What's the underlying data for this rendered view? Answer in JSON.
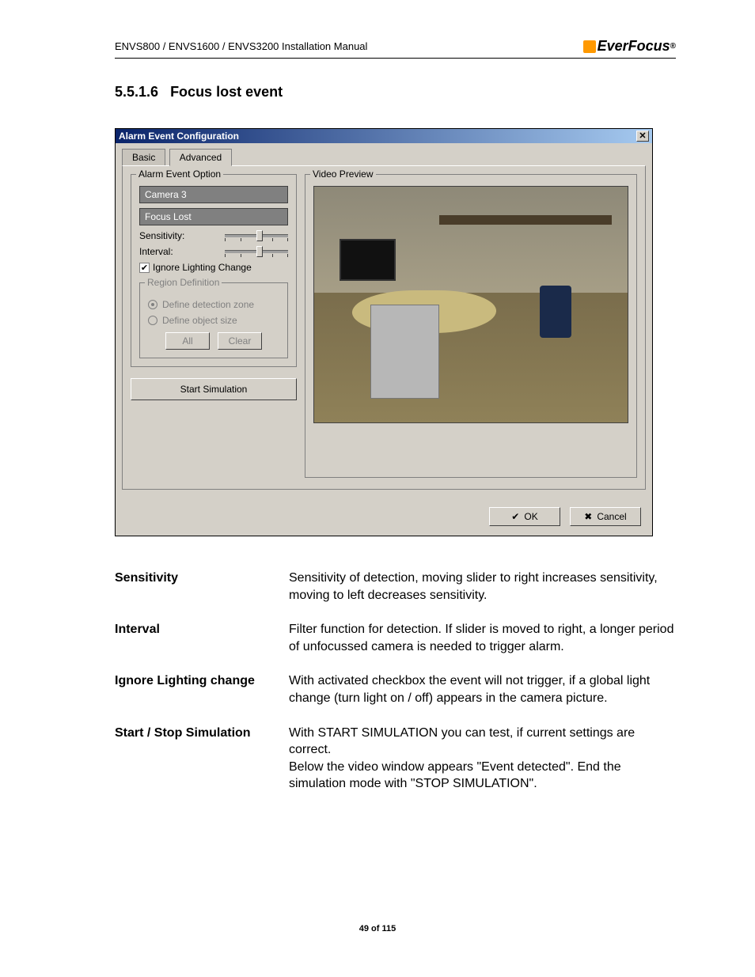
{
  "header": {
    "doc_title": "ENVS800 / ENVS1600 / ENVS3200 Installation Manual",
    "brand": "EverFocus",
    "brand_suffix": "®"
  },
  "section": {
    "number": "5.5.1.6",
    "title": "Focus lost event"
  },
  "dialog": {
    "title": "Alarm Event Configuration",
    "tabs": {
      "basic": "Basic",
      "advanced": "Advanced"
    },
    "alarm_group": {
      "legend": "Alarm Event Option",
      "camera": "Camera 3",
      "event": "Focus Lost",
      "sensitivity_label": "Sensitivity:",
      "interval_label": "Interval:",
      "ignore_label": "Ignore Lighting Change"
    },
    "region_group": {
      "legend": "Region Definition",
      "opt_zone": "Define detection zone",
      "opt_size": "Define object size",
      "btn_all": "All",
      "btn_clear": "Clear"
    },
    "sim_button": "Start Simulation",
    "preview_legend": "Video Preview",
    "ok": "OK",
    "cancel": "Cancel"
  },
  "definitions": [
    {
      "term": "Sensitivity",
      "desc": "Sensitivity of detection, moving slider to right increases sensitivity, moving to left decreases sensitivity."
    },
    {
      "term": "Interval",
      "desc": "Filter function for detection.  If slider is moved to right, a longer period of unfocussed camera  is needed to trigger alarm."
    },
    {
      "term": "Ignore Lighting change",
      "desc": "With activated checkbox the event will not trigger, if a global light change (turn light on / off) appears in the camera picture."
    },
    {
      "term": "Start / Stop Simulation",
      "desc": "With START SIMULATION you can test, if current settings are correct.\nBelow the video window appears \"Event detected\". End the simulation mode with \"STOP SIMULATION\"."
    }
  ],
  "footer": {
    "page": "49 of 115"
  }
}
